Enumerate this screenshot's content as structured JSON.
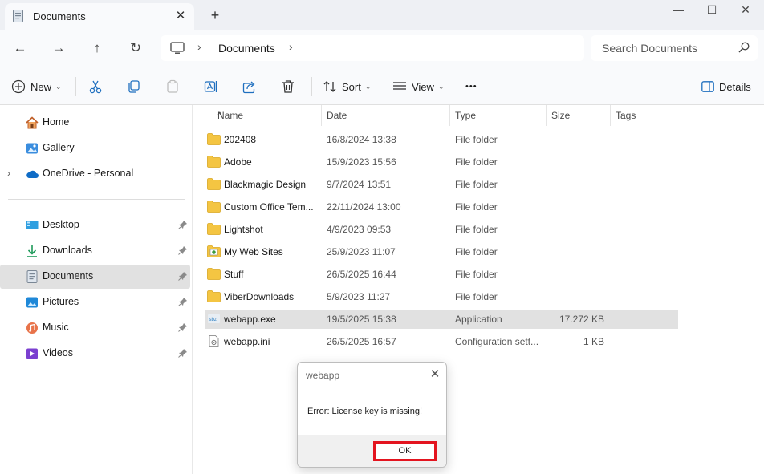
{
  "titlebar": {
    "tab_title": "Documents",
    "tab_close": "✕",
    "new_tab": "+",
    "minimize": "—",
    "maximize": "☐",
    "close": "✕"
  },
  "nav": {
    "back": "←",
    "forward": "→",
    "up": "↑",
    "refresh": "↻",
    "breadcrumb_chevron": "›",
    "location": "Documents",
    "search_placeholder": "Search Documents"
  },
  "commands": {
    "new_label": "New",
    "sort_label": "Sort",
    "view_label": "View",
    "more_label": "•••",
    "details_label": "Details",
    "caret": "⌄"
  },
  "sidebar": {
    "expand_chevron": "›",
    "items": [
      {
        "label": "Home",
        "icon": "home-icon"
      },
      {
        "label": "Gallery",
        "icon": "gallery-icon"
      },
      {
        "label": "OneDrive - Personal",
        "icon": "cloud-icon"
      },
      {
        "label": "Desktop",
        "icon": "desktop-icon"
      },
      {
        "label": "Downloads",
        "icon": "download-icon"
      },
      {
        "label": "Documents",
        "icon": "documents-icon"
      },
      {
        "label": "Pictures",
        "icon": "pictures-icon"
      },
      {
        "label": "Music",
        "icon": "music-icon"
      },
      {
        "label": "Videos",
        "icon": "videos-icon"
      }
    ]
  },
  "columns": {
    "name": "Name",
    "date": "Date",
    "type": "Type",
    "size": "Size",
    "tags": "Tags",
    "sort_indicator": "^"
  },
  "files": [
    {
      "name": "202408",
      "date": "16/8/2024 13:38",
      "type": "File folder",
      "size": "",
      "icon": "folder-icon"
    },
    {
      "name": "Adobe",
      "date": "15/9/2023 15:56",
      "type": "File folder",
      "size": "",
      "icon": "folder-icon"
    },
    {
      "name": "Blackmagic Design",
      "date": "9/7/2024 13:51",
      "type": "File folder",
      "size": "",
      "icon": "folder-icon"
    },
    {
      "name": "Custom Office Tem...",
      "date": "22/11/2024 13:00",
      "type": "File folder",
      "size": "",
      "icon": "folder-icon"
    },
    {
      "name": "Lightshot",
      "date": "4/9/2023 09:53",
      "type": "File folder",
      "size": "",
      "icon": "folder-icon"
    },
    {
      "name": "My Web Sites",
      "date": "25/9/2023 11:07",
      "type": "File folder",
      "size": "",
      "icon": "web-folder-icon"
    },
    {
      "name": "Stuff",
      "date": "26/5/2025 16:44",
      "type": "File folder",
      "size": "",
      "icon": "folder-icon"
    },
    {
      "name": "ViberDownloads",
      "date": "5/9/2023 11:27",
      "type": "File folder",
      "size": "",
      "icon": "folder-icon"
    },
    {
      "name": "webapp.exe",
      "date": "19/5/2025 15:38",
      "type": "Application",
      "size": "17.272 KB",
      "icon": "exe-icon"
    },
    {
      "name": "webapp.ini",
      "date": "26/5/2025 16:57",
      "type": "Configuration sett...",
      "size": "1 KB",
      "icon": "ini-file-icon"
    }
  ],
  "dialog": {
    "title": "webapp",
    "close": "✕",
    "message": "Error: License key is missing!",
    "ok_label": "OK",
    "highlight_color": "#e3141f"
  },
  "colors": {
    "folder": "#f4c542",
    "selection": "#e1e1e1",
    "accent": "#0067c0"
  }
}
